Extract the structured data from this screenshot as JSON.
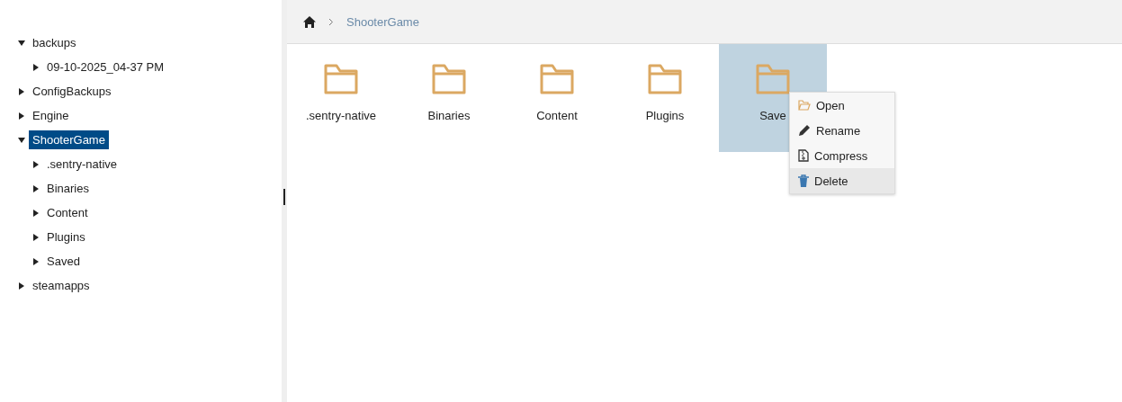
{
  "tree": [
    {
      "label": "backups",
      "expanded": true,
      "selected": false,
      "children": [
        {
          "label": "09-10-2025_04-37 PM",
          "expanded": false,
          "selected": false
        }
      ]
    },
    {
      "label": "ConfigBackups",
      "expanded": false,
      "selected": false
    },
    {
      "label": "Engine",
      "expanded": false,
      "selected": false
    },
    {
      "label": "ShooterGame",
      "expanded": true,
      "selected": true,
      "children": [
        {
          "label": ".sentry-native",
          "expanded": false,
          "selected": false
        },
        {
          "label": "Binaries",
          "expanded": false,
          "selected": false
        },
        {
          "label": "Content",
          "expanded": false,
          "selected": false
        },
        {
          "label": "Plugins",
          "expanded": false,
          "selected": false
        },
        {
          "label": "Saved",
          "expanded": false,
          "selected": false
        }
      ]
    },
    {
      "label": "steamapps",
      "expanded": false,
      "selected": false
    }
  ],
  "breadcrumb": [
    "ShooterGame"
  ],
  "folders": [
    {
      "name": ".sentry-native",
      "selected": false
    },
    {
      "name": "Binaries",
      "selected": false
    },
    {
      "name": "Content",
      "selected": false
    },
    {
      "name": "Plugins",
      "selected": false
    },
    {
      "name": "Save",
      "selected": true
    }
  ],
  "context_menu": [
    {
      "kind": "open",
      "label": "Open",
      "highlighted": false
    },
    {
      "kind": "rename",
      "label": "Rename",
      "highlighted": false
    },
    {
      "kind": "compress",
      "label": "Compress",
      "highlighted": false
    },
    {
      "kind": "delete",
      "label": "Delete",
      "highlighted": true
    }
  ]
}
